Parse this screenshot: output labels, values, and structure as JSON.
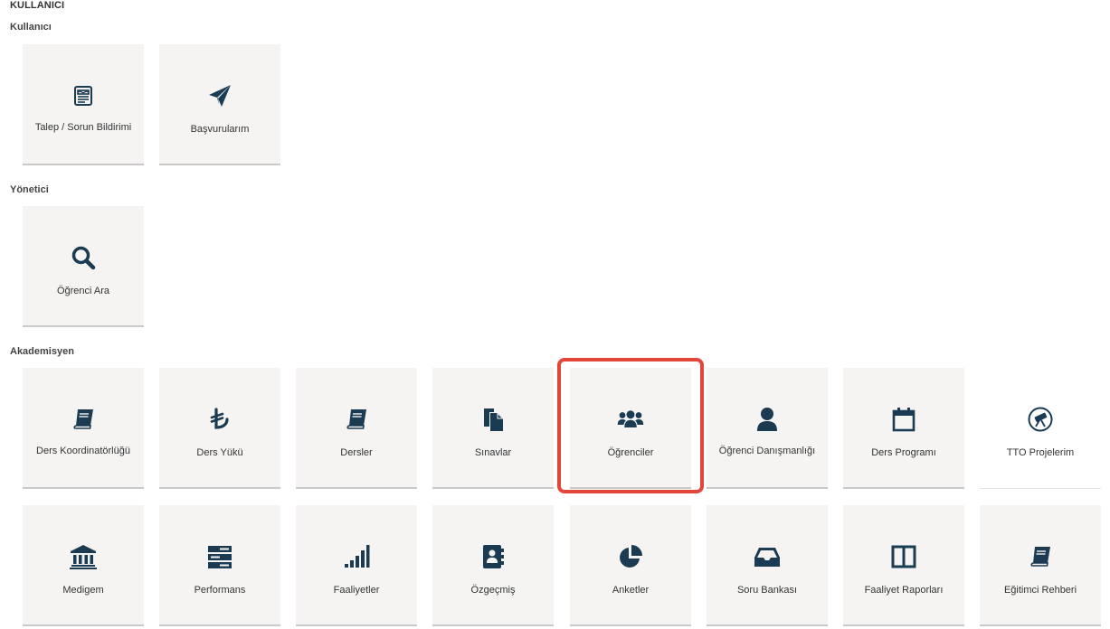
{
  "header": {
    "title": "KULLANICI"
  },
  "sections": {
    "kullanici": {
      "title": "Kullanıcı",
      "tiles": [
        {
          "label": "Talep / Sorun Bildirimi",
          "icon": "newspaper-icon"
        },
        {
          "label": "Başvurularım",
          "icon": "paper-plane-icon"
        }
      ]
    },
    "yonetici": {
      "title": "Yönetici",
      "tiles": [
        {
          "label": "Öğrenci Ara",
          "icon": "search-icon"
        }
      ]
    },
    "akademisyen": {
      "title": "Akademisyen",
      "tiles": [
        {
          "label": "Ders Koordinatörlüğü",
          "icon": "book-icon"
        },
        {
          "label": "Ders Yükü",
          "icon": "lira-icon"
        },
        {
          "label": "Dersler",
          "icon": "book-icon"
        },
        {
          "label": "Sınavlar",
          "icon": "documents-icon"
        },
        {
          "label": "Öğrenciler",
          "icon": "users-icon"
        },
        {
          "label": "Öğrenci Danışmanlığı",
          "icon": "user-icon"
        },
        {
          "label": "Ders Programı",
          "icon": "calendar-icon"
        },
        {
          "label": "TTO Projelerim",
          "icon": "telescope-icon"
        },
        {
          "label": "Medigem",
          "icon": "institution-icon"
        },
        {
          "label": "Performans",
          "icon": "server-icon"
        },
        {
          "label": "Faaliyetler",
          "icon": "signal-bars-icon"
        },
        {
          "label": "Özgeçmiş",
          "icon": "address-book-icon"
        },
        {
          "label": "Anketler",
          "icon": "pie-chart-icon"
        },
        {
          "label": "Soru Bankası",
          "icon": "inbox-icon"
        },
        {
          "label": "Faaliyet Raporları",
          "icon": "columns-icon"
        },
        {
          "label": "Eğitimci Rehberi",
          "icon": "book-icon"
        }
      ]
    }
  },
  "highlight": {
    "target": "Öğrenciler",
    "color": "#e2453a"
  },
  "colors": {
    "icon": "#1b3b53",
    "tile_bg": "#f5f4f3"
  }
}
